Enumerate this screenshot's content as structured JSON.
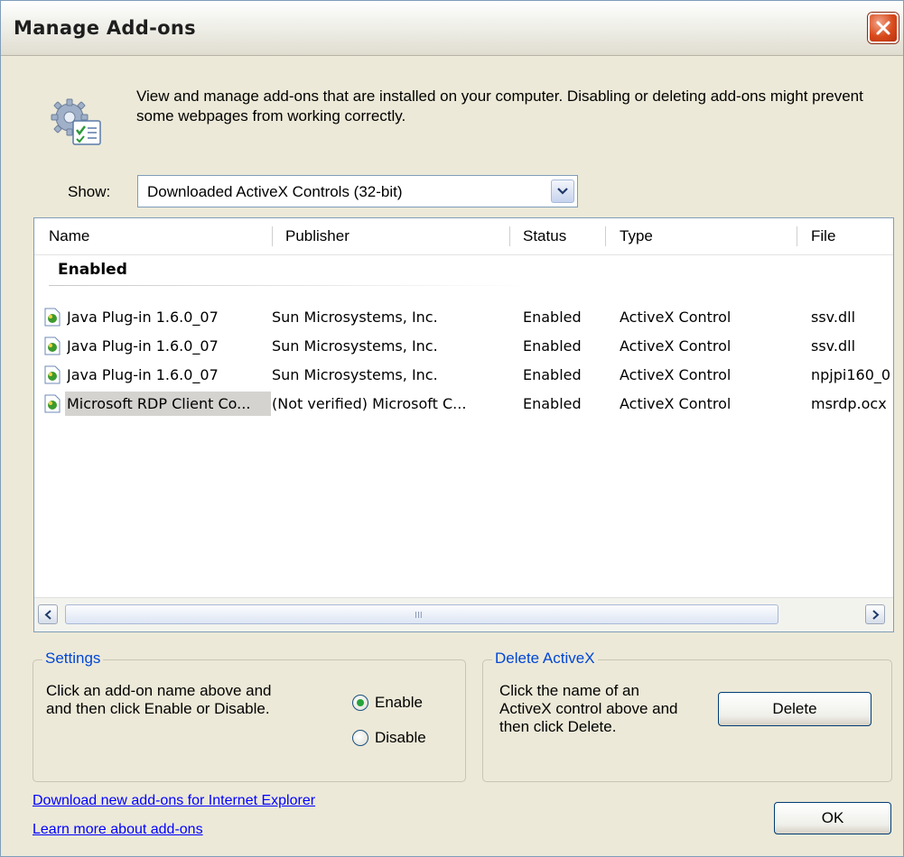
{
  "window": {
    "title": "Manage Add-ons"
  },
  "description": "View and manage add-ons that are installed on your computer. Disabling or deleting add-ons might prevent some webpages from working correctly.",
  "show": {
    "label": "Show:",
    "selected": "Downloaded ActiveX Controls (32-bit)"
  },
  "list": {
    "columns": [
      "Name",
      "Publisher",
      "Status",
      "Type",
      "File"
    ],
    "group": "Enabled",
    "rows": [
      {
        "name": "Java Plug-in 1.6.0_07",
        "publisher": "Sun Microsystems, Inc.",
        "status": "Enabled",
        "type": "ActiveX Control",
        "file": "ssv.dll"
      },
      {
        "name": "Java Plug-in 1.6.0_07",
        "publisher": "Sun Microsystems, Inc.",
        "status": "Enabled",
        "type": "ActiveX Control",
        "file": "ssv.dll"
      },
      {
        "name": "Java Plug-in 1.6.0_07",
        "publisher": "Sun Microsystems, Inc.",
        "status": "Enabled",
        "type": "ActiveX Control",
        "file": "npjpi160_0"
      },
      {
        "name": "Microsoft RDP Client Co...",
        "publisher": "(Not verified) Microsoft C...",
        "status": "Enabled",
        "type": "ActiveX Control",
        "file": "msrdp.ocx",
        "selected": true
      }
    ],
    "scroll_grip": "III"
  },
  "settings": {
    "title": "Settings",
    "text_line1": "Click an add-on name above and",
    "text_line2": "and then click Enable or Disable.",
    "enable_label": "Enable",
    "disable_label": "Disable",
    "selected_option": "Enable"
  },
  "delete_activex": {
    "title": "Delete ActiveX",
    "text_line1": "Click the name of an",
    "text_line2": "ActiveX control above and",
    "text_line3": "then click Delete.",
    "button_label": "Delete"
  },
  "links": {
    "download": "Download new add-ons for Internet Explorer",
    "learn_more": "Learn more about add-ons"
  },
  "ok_label": "OK",
  "colors": {
    "group_title": "#0046d5",
    "link": "#0000ff",
    "close_button": "#d84a1c",
    "selection": "#d4d3d0"
  },
  "icons": [
    "settings-icon",
    "close-icon",
    "dropdown-arrow-icon",
    "activex-control-icon",
    "scroll-left-icon",
    "scroll-right-icon"
  ]
}
